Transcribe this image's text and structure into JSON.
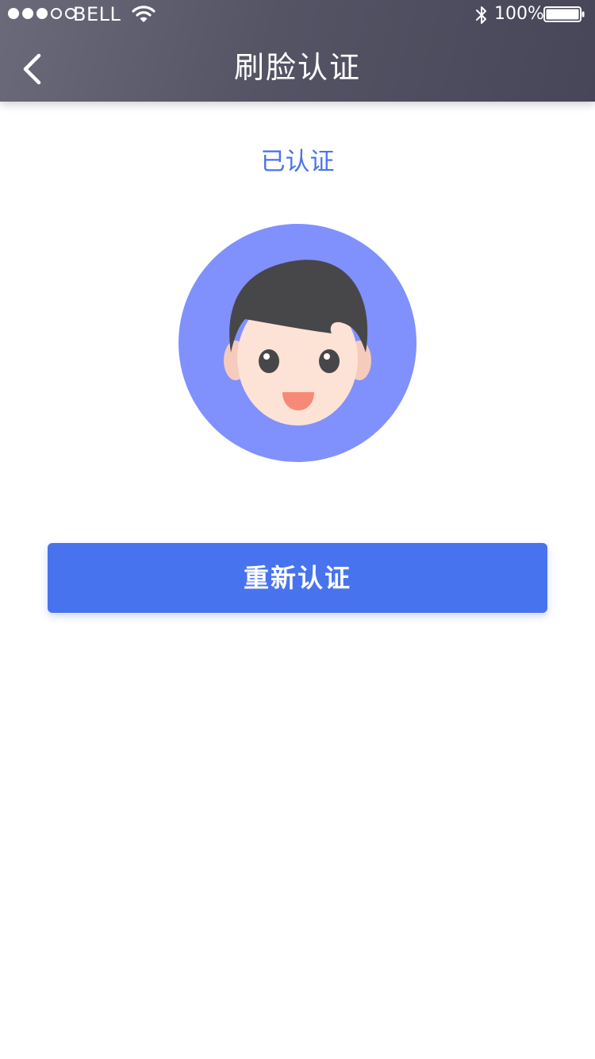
{
  "status_bar": {
    "carrier": "BELL",
    "signal_bars_filled": 3,
    "signal_bars_total": 5,
    "battery_percent": "100%",
    "icons": [
      "signal-dots",
      "wifi-icon",
      "bluetooth-icon",
      "battery-icon"
    ]
  },
  "nav": {
    "back_icon": "chevron-left-icon",
    "title": "刷脸认证"
  },
  "main": {
    "status_text": "已认证",
    "avatar_icon": "face-avatar-icon",
    "reauth_button_label": "重新认证"
  },
  "colors": {
    "header_gradient_start": "#6b6a7a",
    "header_gradient_end": "#474658",
    "accent": "#4873ef",
    "status_text": "#4a74ef",
    "avatar_bg": "#8091fd",
    "hair": "#474749",
    "skin": "#fde2d6"
  }
}
